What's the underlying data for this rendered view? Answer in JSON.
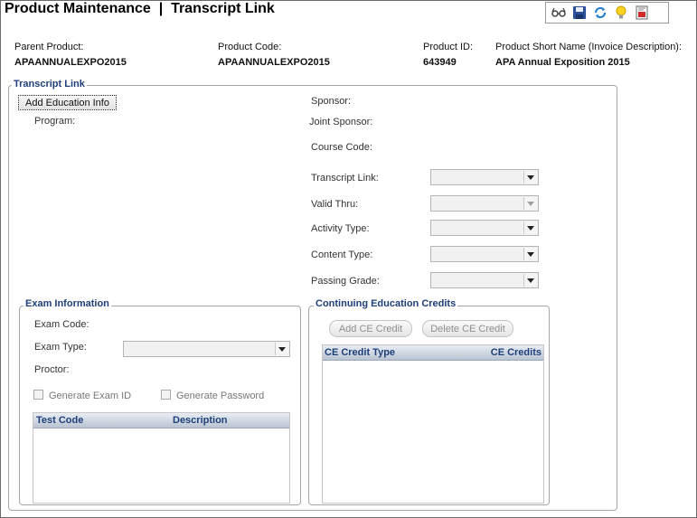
{
  "header": {
    "title": "Product Maintenance  |  Transcript Link",
    "fields": [
      {
        "label": "Parent Product:",
        "value": "APAANNUALEXPO2015"
      },
      {
        "label": "Product Code:",
        "value": "APAANNUALEXPO2015"
      },
      {
        "label": "Product ID:",
        "value": "643949"
      },
      {
        "label": "Product Short Name (Invoice Description):",
        "value": "APA Annual Exposition 2015"
      }
    ]
  },
  "toolbar": {
    "icons": [
      "glasses-icon",
      "save-icon",
      "refresh-icon",
      "lightbulb-icon",
      "report-icon"
    ]
  },
  "transcript": {
    "legend": "Transcript Link",
    "add_education_label": "Add Education Info",
    "program_label": "Program:",
    "sponsor_label": "Sponsor:",
    "joint_sponsor_label": "Joint Sponsor:",
    "course_code_label": "Course Code:",
    "transcript_link_label": "Transcript Link:",
    "valid_thru_label": "Valid Thru:",
    "activity_type_label": "Activity Type:",
    "content_type_label": "Content Type:",
    "passing_grade_label": "Passing Grade:"
  },
  "exam": {
    "legend": "Exam Information",
    "exam_code_label": "Exam Code:",
    "exam_type_label": "Exam Type:",
    "proctor_label": "Proctor:",
    "generate_exam_id_label": "Generate Exam ID",
    "generate_password_label": "Generate Password",
    "grid_columns": [
      "Test Code",
      "Description"
    ]
  },
  "ce": {
    "legend": "Continuing Education Credits",
    "add_button": "Add CE Credit",
    "delete_button": "Delete CE Credit",
    "grid_columns": [
      "CE Credit Type",
      "CE Credits"
    ]
  },
  "colors": {
    "legend_text": "#1f3f7a",
    "grid_header_top": "#e9edf3",
    "grid_header_bottom": "#b8c3d2"
  }
}
